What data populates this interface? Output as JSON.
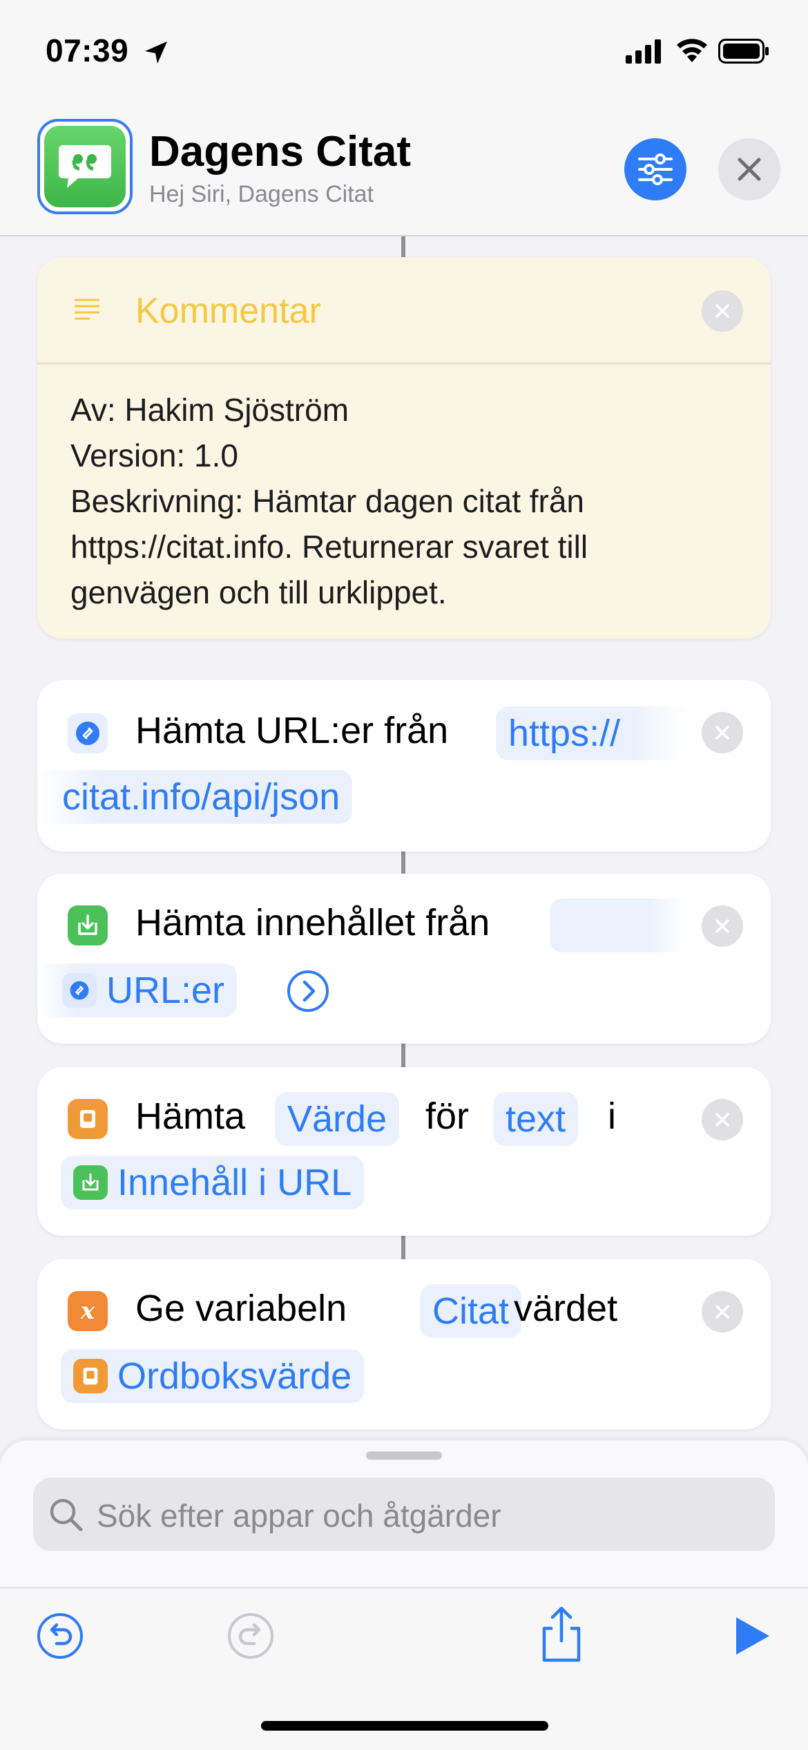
{
  "status_bar": {
    "time": "07:39"
  },
  "header": {
    "title": "Dagens Citat",
    "subtitle": "Hej Siri, Dagens Citat"
  },
  "comment": {
    "title": "Kommentar",
    "lines": [
      "Av: Hakim Sjöström",
      "Version: 1.0",
      "Beskrivning: Hämtar dagen citat från",
      "https://citat.info. Returnerar svaret till",
      "genvägen och till urklippet."
    ]
  },
  "actions": {
    "get_urls": {
      "label": "Hämta URL:er från",
      "url_part1": "https://",
      "url_part2": "citat.info/api/json"
    },
    "get_contents": {
      "label": "Hämta innehållet från",
      "input_token": "URL:er"
    },
    "get_value": {
      "word1": "Hämta",
      "value_token": "Värde",
      "word2": "för",
      "key_token": "text",
      "word3": "i",
      "source_token": "Innehåll i URL"
    },
    "set_variable": {
      "label": "Ge variabeln",
      "var_token": "Citat",
      "word2": "värdet",
      "value_token": "Ordboksvärde"
    }
  },
  "search": {
    "placeholder": "Sök efter appar och åtgärder"
  },
  "colors": {
    "accent": "#2f7cf6",
    "comment_yellow": "#f5c842",
    "comment_bg": "#fbf5e4",
    "green_action": "#4cc159",
    "orange_action": "#f09a37"
  },
  "icons": {
    "header": [
      "quote-bubble-icon",
      "sliders-icon",
      "close-icon"
    ],
    "toolbar": [
      "undo-icon",
      "redo-icon",
      "share-icon",
      "play-icon"
    ]
  }
}
